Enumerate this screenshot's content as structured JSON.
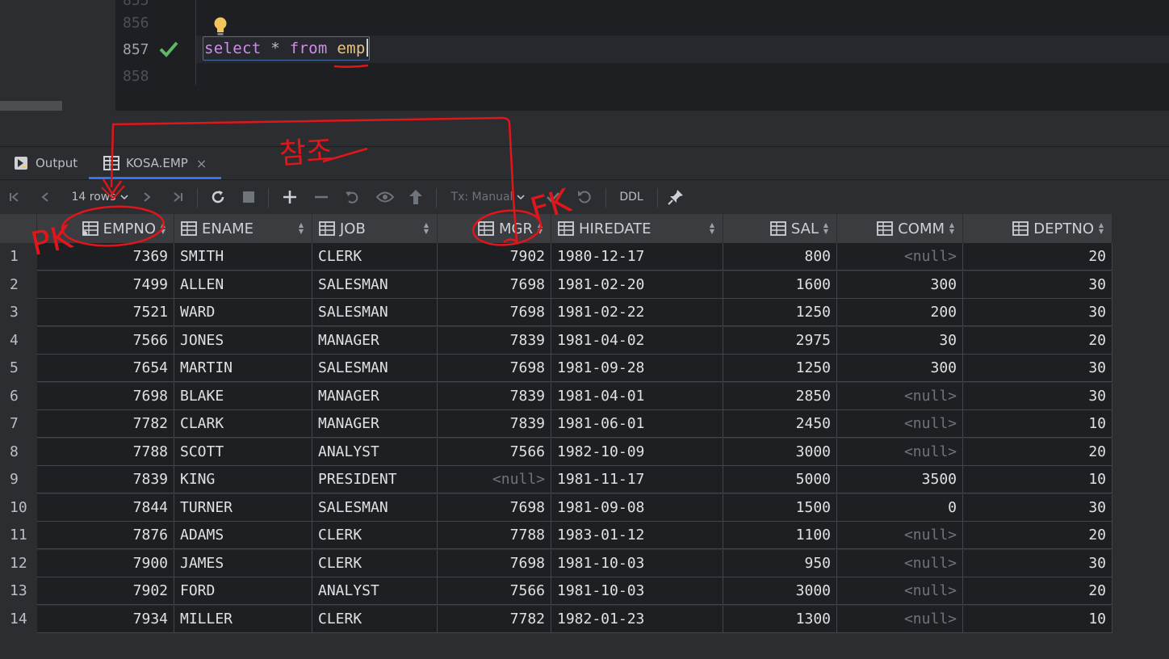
{
  "editor": {
    "line_numbers": [
      "856",
      "857",
      "858"
    ],
    "sql": {
      "kw1": "select",
      "op": "*",
      "kw2": "from",
      "table": "emp"
    }
  },
  "tabs": [
    {
      "label": "Output",
      "icon": "output-icon"
    },
    {
      "label": "KOSA.EMP",
      "icon": "table-icon",
      "close": "×"
    }
  ],
  "toolbar": {
    "rows_label": "14 rows",
    "tx_label": "Tx: Manual",
    "ddl_label": "DDL"
  },
  "grid": {
    "columns": [
      "EMPNO",
      "ENAME",
      "JOB",
      "MGR",
      "HIREDATE",
      "SAL",
      "COMM",
      "DEPTNO"
    ],
    "rows": [
      [
        "1",
        "7369",
        "SMITH",
        "CLERK",
        "7902",
        "1980-12-17",
        "800",
        "<null>",
        "20"
      ],
      [
        "2",
        "7499",
        "ALLEN",
        "SALESMAN",
        "7698",
        "1981-02-20",
        "1600",
        "300",
        "30"
      ],
      [
        "3",
        "7521",
        "WARD",
        "SALESMAN",
        "7698",
        "1981-02-22",
        "1250",
        "200",
        "30"
      ],
      [
        "4",
        "7566",
        "JONES",
        "MANAGER",
        "7839",
        "1981-04-02",
        "2975",
        "30",
        "20"
      ],
      [
        "5",
        "7654",
        "MARTIN",
        "SALESMAN",
        "7698",
        "1981-09-28",
        "1250",
        "300",
        "30"
      ],
      [
        "6",
        "7698",
        "BLAKE",
        "MANAGER",
        "7839",
        "1981-04-01",
        "2850",
        "<null>",
        "30"
      ],
      [
        "7",
        "7782",
        "CLARK",
        "MANAGER",
        "7839",
        "1981-06-01",
        "2450",
        "<null>",
        "10"
      ],
      [
        "8",
        "7788",
        "SCOTT",
        "ANALYST",
        "7566",
        "1982-10-09",
        "3000",
        "<null>",
        "20"
      ],
      [
        "9",
        "7839",
        "KING",
        "PRESIDENT",
        "<null>",
        "1981-11-17",
        "5000",
        "3500",
        "10"
      ],
      [
        "10",
        "7844",
        "TURNER",
        "SALESMAN",
        "7698",
        "1981-09-08",
        "1500",
        "0",
        "30"
      ],
      [
        "11",
        "7876",
        "ADAMS",
        "CLERK",
        "7788",
        "1983-01-12",
        "1100",
        "<null>",
        "20"
      ],
      [
        "12",
        "7900",
        "JAMES",
        "CLERK",
        "7698",
        "1981-10-03",
        "950",
        "<null>",
        "30"
      ],
      [
        "13",
        "7902",
        "FORD",
        "ANALYST",
        "7566",
        "1981-10-03",
        "3000",
        "<null>",
        "20"
      ],
      [
        "14",
        "7934",
        "MILLER",
        "CLERK",
        "7782",
        "1982-01-23",
        "1300",
        "<null>",
        "10"
      ]
    ]
  },
  "annotations": {
    "pk": "PK",
    "fk": "FK",
    "reference": "참조"
  },
  "colors": {
    "annotation": "#e0161b",
    "keyword": "#cf8ee8",
    "table_name": "#e8c483",
    "check": "#5fb865",
    "accent": "#3574f0"
  }
}
